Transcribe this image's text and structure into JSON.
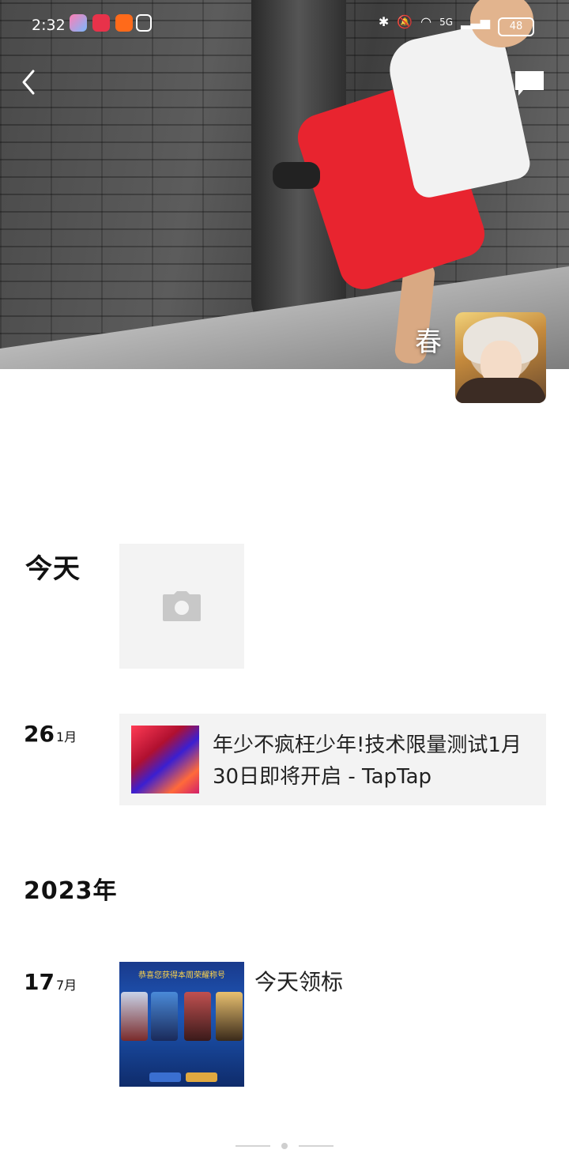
{
  "status_bar": {
    "time": "2:32",
    "network": "5G",
    "battery": "48"
  },
  "profile": {
    "name": "春"
  },
  "timeline": {
    "today_label": "今天",
    "entries": [
      {
        "day": "26",
        "month": "1月",
        "type": "share",
        "title": "年少不疯枉少年!技术限量测试1月30日即将开启 - TapTap"
      },
      {
        "year_label": "2023年"
      },
      {
        "day": "17",
        "month": "7月",
        "type": "image_post",
        "text": "今天领标",
        "image_title": "恭喜您获得本周荣耀称号"
      }
    ]
  }
}
